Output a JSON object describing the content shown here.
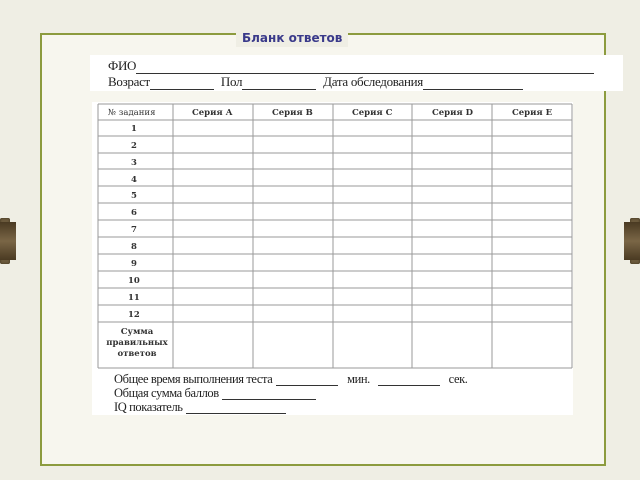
{
  "title": "Бланк ответов",
  "header": {
    "fio_label": "ФИО",
    "age_label": "Возраст",
    "sex_label": "Пол",
    "date_label": "Дата обследования"
  },
  "table": {
    "task_header": "№ задания",
    "series": [
      "Серия А",
      "Серия В",
      "Серия С",
      "Серия D",
      "Серия Е"
    ],
    "rows": [
      "1",
      "2",
      "3",
      "4",
      "5",
      "6",
      "7",
      "8",
      "9",
      "10",
      "11",
      "12"
    ],
    "sum_label": "Сумма правильных ответов"
  },
  "footer": {
    "time_label": "Общее время выполнения теста",
    "min_label": "мин.",
    "sec_label": "сек.",
    "total_label": "Общая сумма баллов",
    "iq_label": "IQ показатель"
  },
  "colors": {
    "frame": "#8c9b3e",
    "title": "#3a3a8a",
    "background": "#efeee4"
  }
}
